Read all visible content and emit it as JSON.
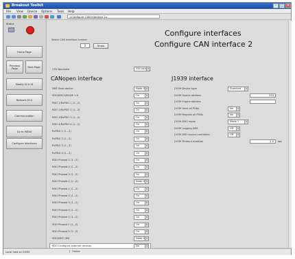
{
  "window": {
    "title": "Breakout Toolkit"
  },
  "menu": [
    "File",
    "View",
    "Device",
    "Options",
    "Tools",
    "Help"
  ],
  "toolbar": {
    "url": "<Configure CAN interface 2>"
  },
  "sidebar": {
    "label": "Status",
    "buttons": [
      {
        "label": "Home Page"
      },
      {
        "label": "Previous Page"
      },
      {
        "label": "Next Page"
      },
      {
        "label": "Modify ECU ID"
      },
      {
        "label": "Network ECU"
      },
      {
        "label": "Communication"
      },
      {
        "label": "Go to MENU"
      },
      {
        "label": "Configure Interfaces"
      }
    ]
  },
  "main": {
    "title1": "Configure interfaces",
    "title2": "Configure CAN interface 2",
    "hint": "Select CAN interface number",
    "interface_number": "2",
    "show_button": "Show",
    "cpu_select_label": "CPU Baudrate",
    "cpu_select_value": "250 kb/s",
    "canopen": {
      "heading": "CANopen interface",
      "rows": [
        {
          "label": "NMT Boot device",
          "value": "Node ID 1"
        },
        {
          "label": "SDO/EMCY/NODE 1-8",
          "value": "On"
        },
        {
          "label": "RDO 1/RxPDO 1 (1...2)",
          "value": "On"
        },
        {
          "label": "RDO 2/RxPDO 2 (1...2)",
          "value": "On"
        },
        {
          "label": "RDO 3/RxPDO 3 (1...2)",
          "value": "On"
        },
        {
          "label": "RDO 4/RxPDO 4 (1...2)",
          "value": "On"
        },
        {
          "label": "RxPDO 1 (1...2)",
          "value": "On"
        },
        {
          "label": "RxPDO 2 (1...2)",
          "value": "On"
        },
        {
          "label": "RxPDO 3 (1...2)",
          "value": "On"
        },
        {
          "label": "RxPDO 4 (1...2)",
          "value": "On"
        },
        {
          "label": "RDO Phased 1 (1...2)",
          "value": "On"
        },
        {
          "label": "RDO Phased 2 (1...2)",
          "value": "On"
        },
        {
          "label": "RDO Phased 3 (1...2)",
          "value": "On"
        },
        {
          "label": "RDO Phased 4 (1...2)",
          "value": "Node ID 1"
        },
        {
          "label": "RDO Phased 1 (1...2)",
          "value": "On"
        },
        {
          "label": "RDO Phased 2 (1...2)",
          "value": "On"
        },
        {
          "label": "RDO Phased 3 (1...2)",
          "value": "On"
        },
        {
          "label": "RDO Phased 4 (1...2)",
          "value": "On"
        },
        {
          "label": "RDO Phased 1 (1...2)",
          "value": "On"
        },
        {
          "label": "SDO Phased 2 (1...2)",
          "value": "On"
        },
        {
          "label": "SDO Phased 3 (1...2)",
          "value": "On"
        },
        {
          "label": "SDO/NMT (IM)",
          "value": "Node ID 1"
        },
        {
          "label": "PDO Configure external devices",
          "value": "No"
        }
      ]
    },
    "j1939": {
      "heading": "J1939 interface",
      "rows": [
        {
          "label": "J1939 Device type",
          "value": "Standard",
          "kind": "select"
        },
        {
          "label": "J1939 Source address",
          "value": "253",
          "kind": "text"
        },
        {
          "label": "J1939 Engine address",
          "value": "",
          "kind": "text"
        },
        {
          "label": "J1939 Send all PGNs",
          "value": "No",
          "kind": "select"
        },
        {
          "label": "J1939 Request all PGNs",
          "value": "No",
          "kind": "select"
        },
        {
          "label": "J1939 DM1 mode",
          "value": "Mode 1",
          "kind": "select"
        },
        {
          "label": "J1939 Logging DM1",
          "value": "Off",
          "kind": "select"
        },
        {
          "label": "J1939 DM1 source controlled",
          "value": "Off",
          "kind": "select"
        },
        {
          "label": "J1939 Timeout duration",
          "value": "1.0",
          "kind": "text",
          "unit": "sec"
        }
      ]
    }
  },
  "status": {
    "left": "Local host on COM1",
    "right": "Online"
  }
}
